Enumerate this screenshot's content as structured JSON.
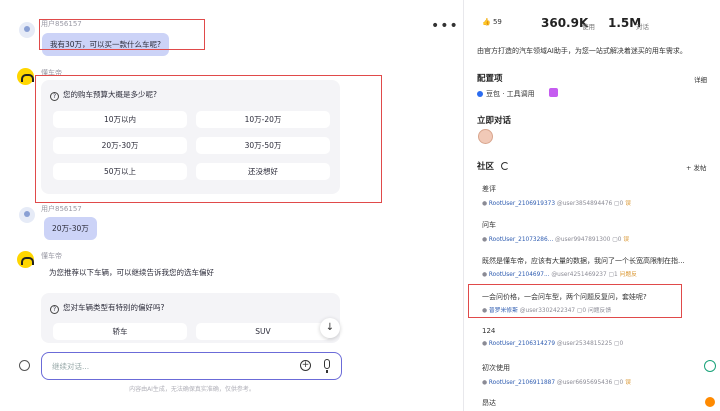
{
  "chat": {
    "msg1_user": "用户856157",
    "msg1_text": "我有30万，可以买一款什么车呢?",
    "bot_name": "懂车帝",
    "card1_question": "您的购车预算大概是多少呢?",
    "card1_options": [
      "10万以内",
      "10万-20万",
      "20万-30万",
      "30万-50万",
      "50万以上",
      "还没想好"
    ],
    "msg2_user": "用户856157",
    "msg2_text": "20万-30万",
    "bot_name2": "懂车帝",
    "bot_text2": "为您推荐以下车辆，可以继续告诉我您的选车偏好",
    "card2_question": "您对车辆类型有特别的偏好吗?",
    "card2_options": [
      "轿车",
      "SUV"
    ],
    "input_placeholder": "继续对话...",
    "disclaimer": "内容由AI生成，无法确保真实准确，仅供参考。",
    "more_label": "•••",
    "scroll_label": "↓",
    "plus_label": "+"
  },
  "side": {
    "likes": "59",
    "uses_value": "360.9K",
    "uses_label": "使用",
    "dialogs_value": "1.5M",
    "dialogs_label": "对话",
    "description": "由官方打造的汽车领域AI助手，为您一站式解决着迷买的用车需求。",
    "config_title": "配置项",
    "config_detail": "详细",
    "config_item": "豆包 · 工具调用",
    "dialog_title": "立即对话",
    "community_title": "社区",
    "post_action": "+ 发帖",
    "posts": [
      {
        "title": "差评",
        "user": "RootUser_2106919373",
        "handle": "@user3854894476",
        "comments": "0",
        "extra": "误"
      },
      {
        "title": "问车",
        "user": "RootUser_21073286...",
        "handle": "@user9947891300",
        "comments": "0",
        "extra": "误"
      },
      {
        "title": "既然是懂车帝，应该有大量的数据，我问了一个长宽高限制在指...",
        "user": "RootUser_2104697...",
        "handle": "@user4251469237",
        "comments": "1",
        "extra": "问题反"
      },
      {
        "title": "一会问价格，一会问车型，两个问题反复问，套娃呢?",
        "user": "普罗米修斯",
        "handle": "@user3302422347",
        "comments": "0",
        "extra": "问题反馈"
      },
      {
        "title": "124",
        "user": "RootUser_2106314279",
        "handle": "@user2534815225",
        "comments": "0",
        "extra": ""
      },
      {
        "title": "初次使用",
        "user": "RootUser_2106911887",
        "handle": "@user6695695436",
        "comments": "0",
        "extra": "误"
      },
      {
        "title": "昂达",
        "user": "",
        "handle": "",
        "comments": "",
        "extra": ""
      }
    ]
  },
  "colors": {
    "accent": "#6b6bd8",
    "user_bubble": "#ccd3f7",
    "annotation_red": "#e04a4a"
  }
}
